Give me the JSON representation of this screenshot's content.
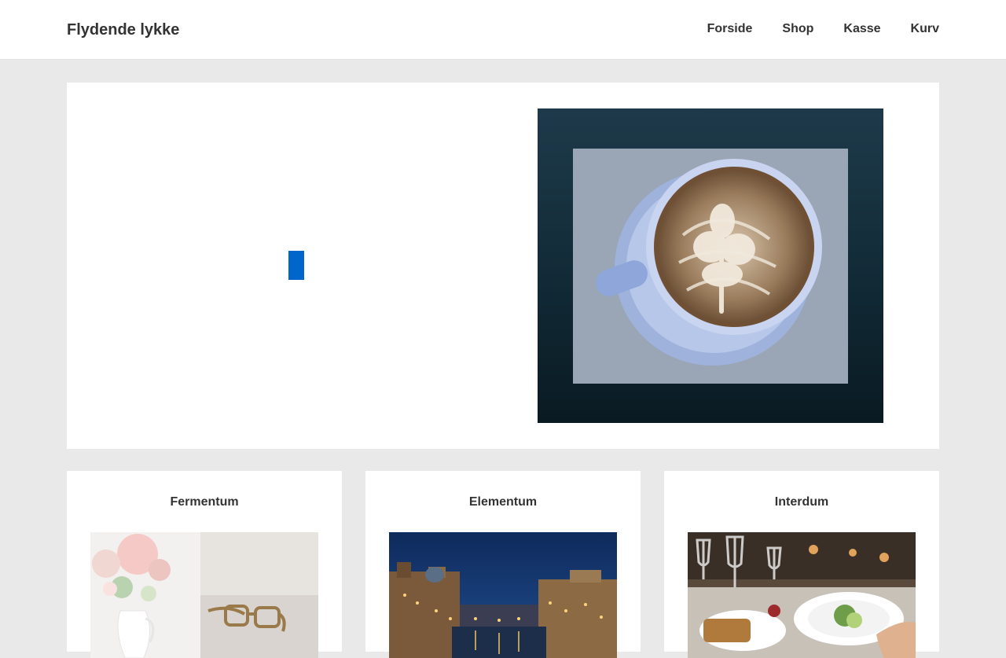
{
  "header": {
    "site_title": "Flydende lykke",
    "nav": [
      {
        "label": "Forside"
      },
      {
        "label": "Shop"
      },
      {
        "label": "Kasse"
      },
      {
        "label": "Kurv"
      }
    ]
  },
  "hero": {
    "button_color": "#0066cc",
    "image_icon": "latte-art-coffee-cup"
  },
  "cards": [
    {
      "title": "Fermentum",
      "image_icon": "flowers-vase-glasses"
    },
    {
      "title": "Elementum",
      "image_icon": "venice-canal-night"
    },
    {
      "title": "Interdum",
      "image_icon": "restaurant-table-dinner"
    }
  ]
}
